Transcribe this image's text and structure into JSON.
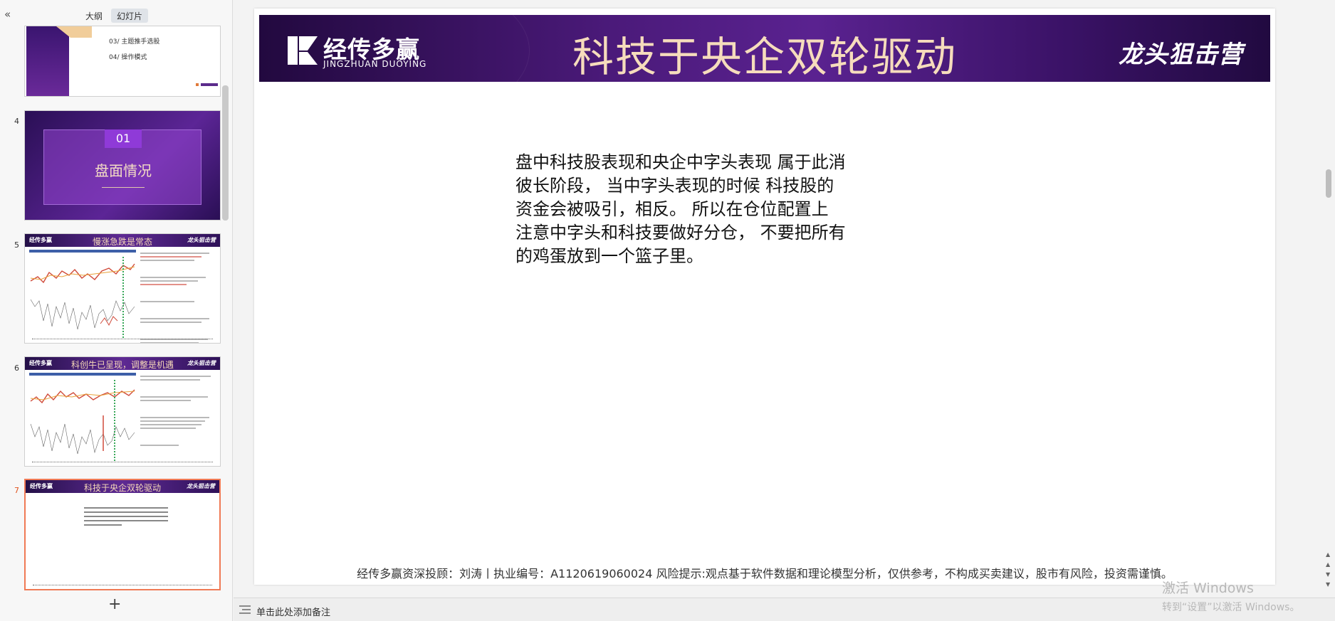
{
  "left_panel": {
    "tabs": [
      "大纲",
      "幻灯片"
    ],
    "active_tab": 1,
    "slides": [
      {
        "number": "",
        "agenda": [
          "03/ 主题推手选股",
          "04/ 操作模式"
        ]
      },
      {
        "number": "4",
        "badge": "01",
        "title": "盘面情况"
      },
      {
        "number": "5",
        "title": "慢涨急跌是常态"
      },
      {
        "number": "6",
        "title": "科创牛已呈现，调整是机遇"
      },
      {
        "number": "7",
        "title": "科技于央企双轮驱动"
      }
    ],
    "add_slide_label": "+"
  },
  "slide": {
    "title": "科技于央企双轮驱动",
    "logo_cn": "经传多赢",
    "logo_en": "JINGZHUAN DUOYING",
    "brand_right": "龙头狙击营",
    "body_lines": [
      "盘中科技股表现和央企中字头表现 属于此消",
      "彼长阶段， 当中字头表现的时候 科技股的",
      "资金会被吸引，相反。 所以在仓位配置上",
      "注意中字头和科技要做好分仓， 不要把所有",
      "的鸡蛋放到一个篮子里。"
    ],
    "disclaimer": "经传多赢资深投顾：刘涛丨执业编号：A1120619060024  风险提示:观点基于软件数据和理论模型分析，仅供参考，不构成买卖建议，股市有风险，投资需谨慎。"
  },
  "notes": {
    "label": "单击此处添加备注"
  },
  "watermark": {
    "line1": "激活 Windows",
    "line2": "转到“设置”以激活 Windows。"
  },
  "colors": {
    "accent_orange": "#f07a55",
    "banner_purple": "#4b1a7a",
    "title_gold": "#f6dcbc"
  }
}
